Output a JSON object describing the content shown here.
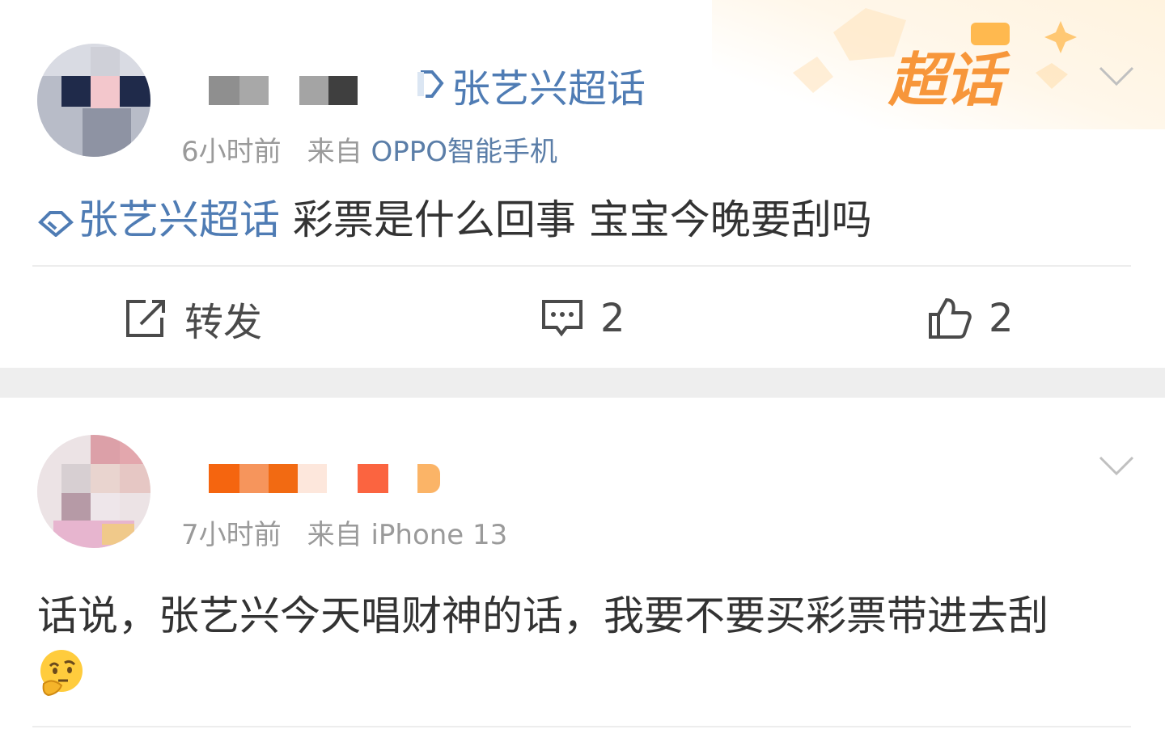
{
  "posts": [
    {
      "topic_header": "张艺兴超话",
      "badge": "超话",
      "timestamp": "6小时前",
      "source_prefix": "来自",
      "source": "OPPO智能手机",
      "topic_tag": "张艺兴超话",
      "text": "彩票是什么回事 宝宝今晚要刮吗",
      "actions": {
        "repost_label": "转发",
        "comment_count": "2",
        "like_count": "2"
      }
    },
    {
      "timestamp": "7小时前",
      "source_prefix": "来自",
      "source": "iPhone 13",
      "text": "话说，张艺兴今天唱财神的话，我要不要买彩票带进去刮"
    }
  ],
  "colors": {
    "topic_blue": "#4f7cb4",
    "badge_orange": "#f7963a",
    "text": "#333333",
    "meta": "#9a9a9a"
  },
  "icons": [
    "chevron-down-icon",
    "topic-diamond-icon",
    "repost-icon",
    "comment-icon",
    "like-icon",
    "thinking-face-emoji"
  ]
}
